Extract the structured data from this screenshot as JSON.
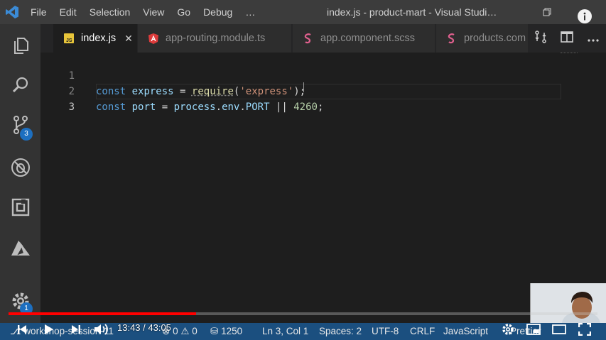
{
  "titlebar": {
    "menu": [
      "File",
      "Edit",
      "Selection",
      "View",
      "Go",
      "Debug",
      "…"
    ],
    "window_title": "index.js - product-mart - Visual Studi…"
  },
  "activity_bar": {
    "items": [
      {
        "name": "explorer-icon"
      },
      {
        "name": "search-icon"
      },
      {
        "name": "source-control-icon",
        "badge": "3"
      },
      {
        "name": "debug-icon"
      },
      {
        "name": "extensions-icon"
      },
      {
        "name": "azure-icon"
      }
    ],
    "settings_badge": "1"
  },
  "tabs": [
    {
      "label": "index.js",
      "icon": "js-file-icon",
      "active": true
    },
    {
      "label": "app-routing.module.ts",
      "icon": "angular-icon",
      "active": false
    },
    {
      "label": "app.component.scss",
      "icon": "sass-icon",
      "active": false
    },
    {
      "label": "products.com",
      "icon": "sass-icon",
      "active": false
    }
  ],
  "editor": {
    "lines": [
      {
        "number": "1",
        "tokens": {
          "kw": "const",
          "sp1": " ",
          "var": "express",
          "eq": " = ",
          "fn": "require",
          "open": "(",
          "str": "'express'",
          "close": ");"
        }
      },
      {
        "number": "2",
        "tokens": {
          "kw": "const",
          "sp1": " ",
          "var": "port",
          "eq": " = ",
          "obj": "process",
          "dot1": ".",
          "prop1": "env",
          "dot2": ".",
          "prop2": "PORT",
          "op": " || ",
          "num": "4260",
          "semi": ";"
        }
      },
      {
        "number": "3"
      }
    ]
  },
  "player": {
    "time": "13:43 / 43:05",
    "progress": 0.3185
  },
  "statusbar": {
    "branch": "workshop-session-11",
    "errors": "0",
    "warnings": "0",
    "db": "1250",
    "position": "Ln 3, Col 1",
    "spaces": "Spaces: 2",
    "encoding": "UTF-8",
    "eol": "CRLF",
    "language": "JavaScript",
    "formatter": "Prettier"
  },
  "colors": {
    "accent": "#1d6fc0",
    "progress": "#ff0000",
    "statusbar": "#1b4f7f"
  }
}
